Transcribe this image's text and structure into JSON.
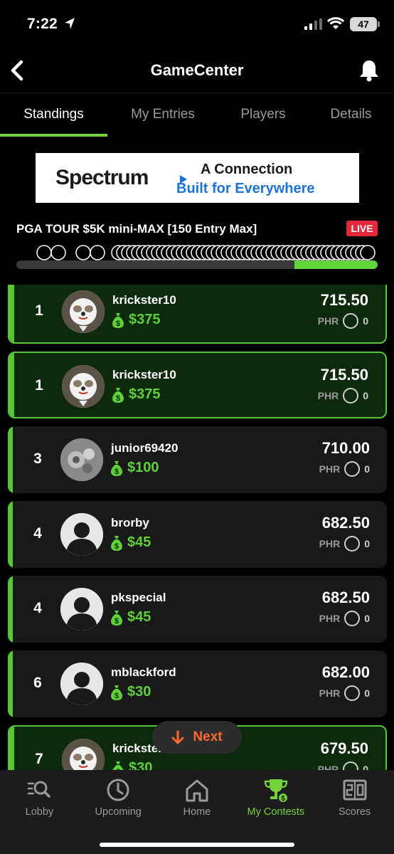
{
  "status_bar": {
    "time": "7:22",
    "battery": "47"
  },
  "nav": {
    "title": "GameCenter",
    "back_icon": "chevron-left-icon",
    "bell_icon": "bell-icon"
  },
  "tabs": [
    {
      "label": "Standings",
      "active": true
    },
    {
      "label": "My Entries",
      "active": false
    },
    {
      "label": "Players",
      "active": false
    },
    {
      "label": "Details",
      "active": false
    }
  ],
  "ad": {
    "brand": "Spectrum",
    "line1": "A Connection",
    "line2": "Built for Everywhere"
  },
  "contest": {
    "name": "PGA TOUR $5K mini-MAX [150 Entry Max]",
    "status": "LIVE",
    "progress_fraction": 0.23
  },
  "standings": [
    {
      "rank": "1",
      "user": "krickster10",
      "prize": "$375",
      "score": "715.50",
      "phr_label": "PHR",
      "phr": "0",
      "mine": true,
      "avatar": "dog"
    },
    {
      "rank": "1",
      "user": "krickster10",
      "prize": "$375",
      "score": "715.50",
      "phr_label": "PHR",
      "phr": "0",
      "mine": true,
      "avatar": "dog"
    },
    {
      "rank": "3",
      "user": "junior69420",
      "prize": "$100",
      "score": "710.00",
      "phr_label": "PHR",
      "phr": "0",
      "mine": false,
      "avatar": "photo"
    },
    {
      "rank": "4",
      "user": "brorby",
      "prize": "$45",
      "score": "682.50",
      "phr_label": "PHR",
      "phr": "0",
      "mine": false,
      "avatar": "default"
    },
    {
      "rank": "4",
      "user": "pkspecial",
      "prize": "$45",
      "score": "682.50",
      "phr_label": "PHR",
      "phr": "0",
      "mine": false,
      "avatar": "default"
    },
    {
      "rank": "6",
      "user": "mblackford",
      "prize": "$30",
      "score": "682.00",
      "phr_label": "PHR",
      "phr": "0",
      "mine": false,
      "avatar": "default"
    },
    {
      "rank": "7",
      "user": "krickster10",
      "prize": "$30",
      "score": "679.50",
      "phr_label": "PHR",
      "phr": "0",
      "mine": true,
      "avatar": "dog"
    }
  ],
  "next_button": {
    "label": "Next",
    "icon": "arrow-down-icon"
  },
  "bottom_nav": [
    {
      "label": "Lobby",
      "icon": "lobby-search-icon",
      "active": false
    },
    {
      "label": "Upcoming",
      "icon": "clock-icon",
      "active": false
    },
    {
      "label": "Home",
      "icon": "home-icon",
      "active": false
    },
    {
      "label": "My Contests",
      "icon": "trophy-icon",
      "active": true
    },
    {
      "label": "Scores",
      "icon": "scoreboard-icon",
      "active": false
    }
  ],
  "colors": {
    "accent": "#74d23b",
    "live": "#e3283b",
    "next": "#ff6a2b"
  }
}
